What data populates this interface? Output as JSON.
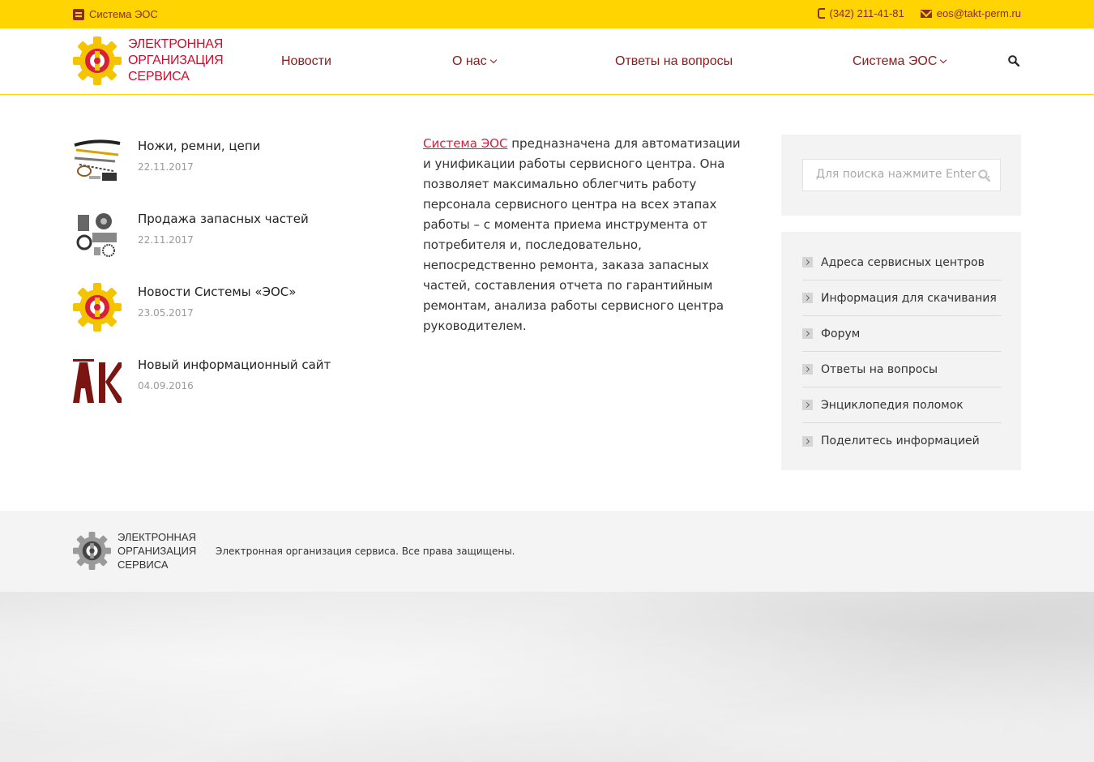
{
  "topbar": {
    "brand_link": "Система ЭОС",
    "phone": "(342) 211-41-81",
    "email": "eos@takt-perm.ru"
  },
  "header": {
    "logo_lines": [
      "ЭЛЕКТРОННАЯ",
      "ОРГАНИЗАЦИЯ",
      "СЕРВИСА"
    ],
    "nav": {
      "news": "Новости",
      "about": "О нас",
      "faq": "Ответы на вопросы",
      "system": "Система ЭОС"
    }
  },
  "posts": [
    {
      "title": "Ножи, ремни, цепи",
      "date": "22.11.2017",
      "icon": "belts-thumbnail"
    },
    {
      "title": "Продажа запасных частей",
      "date": "22.11.2017",
      "icon": "spare-parts-thumbnail"
    },
    {
      "title": "Новости Системы «ЭОС»",
      "date": "23.05.2017",
      "icon": "eos-logo-thumbnail"
    },
    {
      "title": "Новый информационный сайт",
      "date": "04.09.2016",
      "icon": "ak-logo-thumbnail"
    }
  ],
  "about": {
    "link": "Система ЭОС",
    "text": " предназначена для автоматизации и унификации работы сервисного центра. Она позволяет максимально облегчить работу персонала сервисного центра на всех этапах работы – с момента приема инструмента от потребителя и, последовательно, непосредственно ремонта, заказа запасных частей, составления отчета по гарантийным ремонтам, анализа работы сервисного центра руководителем."
  },
  "sidebar": {
    "search_placeholder": "Для поиска нажмите Enter ...",
    "menu": [
      "Адреса сервисных центров",
      "Информация для скачивания",
      "Форум",
      "Ответы на вопросы",
      "Энциклопедия поломок",
      "Поделитесь информацией"
    ]
  },
  "footer": {
    "logo_lines": [
      "ЭЛЕКТРОННАЯ",
      "ОРГАНИЗАЦИЯ",
      "СЕРВИСА"
    ],
    "copyright": "Электронная организация сервиса. Все права защищены."
  },
  "colors": {
    "topbar": "#ffd400",
    "brand_red": "#c8102e",
    "nav_text": "#8b1a1a",
    "link": "#d8203a"
  }
}
